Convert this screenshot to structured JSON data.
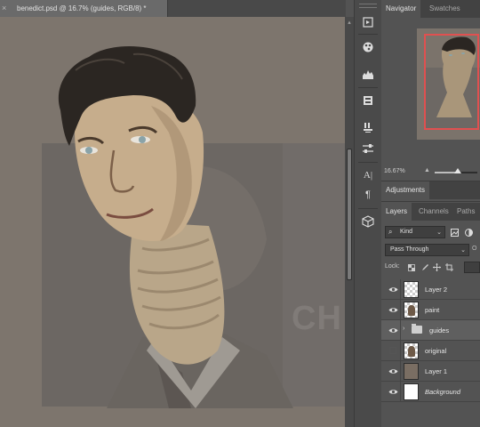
{
  "document": {
    "tab_title": "benedict.psd @ 16.7% (guides, RGB/8) *",
    "close_glyph": "×",
    "canvas_watermark": "CH"
  },
  "tools": [
    {
      "name": "history-icon",
      "glyph": "⟲"
    },
    {
      "name": "color-palette-icon",
      "glyph": "◉"
    },
    {
      "name": "histogram-icon",
      "glyph": "▟"
    },
    {
      "name": "properties-icon",
      "glyph": "⚙"
    },
    {
      "name": "brush-presets-icon",
      "glyph": "✎"
    },
    {
      "name": "adjustment-sliders-icon",
      "glyph": "⇄"
    },
    {
      "name": "character-icon",
      "glyph": "A|"
    },
    {
      "name": "paragraph-icon",
      "glyph": "¶"
    },
    {
      "name": "3d-cube-icon",
      "glyph": "⬡"
    }
  ],
  "navigator": {
    "tab_navigator": "Navigator",
    "tab_swatches": "Swatches",
    "zoom_value": "16.67%",
    "zoom_small_icon": "▲",
    "zoom_level": 0.55
  },
  "adjustments": {
    "tab": "Adjustments"
  },
  "layers_panel": {
    "tab_layers": "Layers",
    "tab_channels": "Channels",
    "tab_paths": "Paths",
    "kind_label": "Kind",
    "kind_icon": "⌕",
    "blend_mode": "Pass Through",
    "opacity_label": "O",
    "lock_label": "Lock:",
    "dropdown_arrow": "⌄",
    "layers": [
      {
        "name": "Layer 2",
        "visible": true,
        "thumb": "checker",
        "italic": false
      },
      {
        "name": "paint",
        "visible": true,
        "thumb": "checker-figure",
        "italic": false
      },
      {
        "name": "guides",
        "visible": true,
        "thumb": "folder",
        "italic": false,
        "selected": true
      },
      {
        "name": "original",
        "visible": false,
        "thumb": "checker-figure",
        "italic": false
      },
      {
        "name": "Layer 1",
        "visible": true,
        "thumb": "solid",
        "italic": false
      },
      {
        "name": "Background",
        "visible": true,
        "thumb": "white",
        "italic": true
      }
    ]
  },
  "colors": {
    "canvas_bg": "#7d756d",
    "navigator_frame": "#e05050",
    "panel_bg": "#535353"
  }
}
